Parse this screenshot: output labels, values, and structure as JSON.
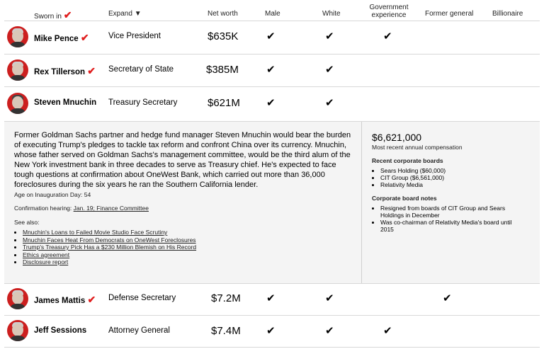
{
  "header": {
    "sworn_in": "Sworn in",
    "expand": "Expand ▼",
    "net_worth": "Net worth",
    "male": "Male",
    "white": "White",
    "gov_exp": "Government experience",
    "former_general": "Former general",
    "billionaire": "Billionaire"
  },
  "rows": [
    {
      "name": "Mike Pence",
      "sworn": true,
      "position": "Vice President",
      "net_worth": "$635K",
      "male": true,
      "white": true,
      "gov": true,
      "general": false,
      "billionaire": false
    },
    {
      "name": "Rex Tillerson",
      "sworn": true,
      "position": "Secretary of State",
      "net_worth": "$385M",
      "male": true,
      "white": true,
      "gov": false,
      "general": false,
      "billionaire": false
    },
    {
      "name": "Steven Mnuchin",
      "sworn": false,
      "position": "Treasury Secretary",
      "net_worth": "$621M",
      "male": true,
      "white": true,
      "gov": false,
      "general": false,
      "billionaire": false
    },
    {
      "name": "James Mattis",
      "sworn": true,
      "position": "Defense Secretary",
      "net_worth": "$7.2M",
      "male": true,
      "white": true,
      "gov": false,
      "general": true,
      "billionaire": false
    },
    {
      "name": "Jeff Sessions",
      "sworn": false,
      "position": "Attorney General",
      "net_worth": "$7.4M",
      "male": true,
      "white": true,
      "gov": true,
      "general": false,
      "billionaire": false
    }
  ],
  "detail": {
    "bio": "Former Goldman Sachs partner and hedge fund manager Steven Mnuchin would bear the burden of executing Trump's pledges to tackle tax reform and confront China over its currency. Mnuchin, whose father served on Goldman Sachs's management committee, would be the third alum of the New York investment bank in three decades to serve as Treasury chief. He's expected to face tough questions at confirmation about OneWest Bank, which carried out more than 36,000 foreclosures during the six years he ran the Southern California lender.",
    "age": "Age on Inauguration Day: 54",
    "confirmation_label": "Confirmation hearing:",
    "confirmation_link": "Jan. 19; Finance Committee",
    "see_also": "See also:",
    "links": [
      "Mnuchin's Loans to Failed Movie Studio Face Scrutiny",
      "Mnuchin Faces Heat From Democrats on OneWest Foreclosures",
      "Trump's Treasury Pick Has a $230 Million Blemish on His Record",
      "Ethics agreement",
      "Disclosure report"
    ],
    "compensation": "$6,621,000",
    "compensation_label": "Most recent annual compensation",
    "boards_title": "Recent corporate boards",
    "boards": [
      "Sears Holding ($60,000)",
      "CIT Group ($6,561,000)",
      "Relativity Media"
    ],
    "notes_title": "Corporate board notes",
    "notes": [
      "Resigned from boards of CIT Group and Sears Holdings in December",
      "Was co-chairman of Relativity Media's board until 2015"
    ]
  },
  "glyphs": {
    "check": "✔",
    "sworn_check": "✔"
  },
  "colors": {
    "accent": "#e01e1e",
    "avatar_bg": "#cc1f1f",
    "detail_bg": "#f4f4f4"
  }
}
